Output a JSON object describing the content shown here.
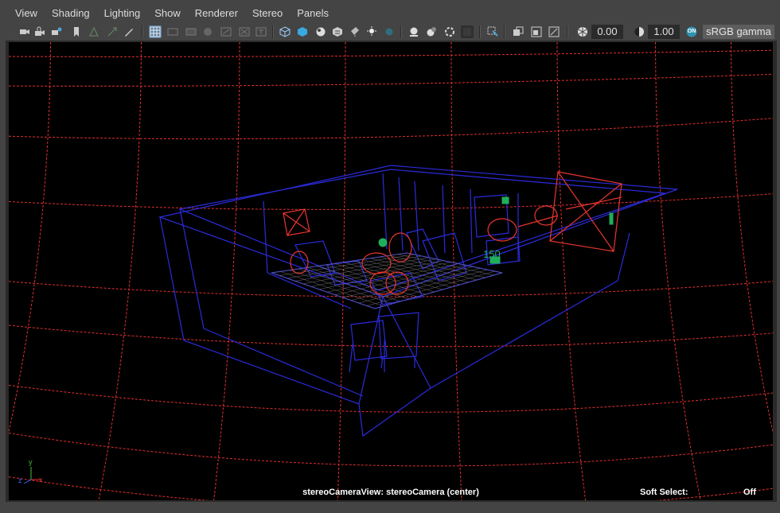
{
  "menu": [
    "View",
    "Shading",
    "Lighting",
    "Show",
    "Renderer",
    "Stereo",
    "Panels"
  ],
  "toolbar": {
    "exposure_value": "0.00",
    "gamma_value": "1.00",
    "color_management_badge": "ON",
    "color_space": "sRGB gamma",
    "icons": [
      "camera-select-icon",
      "camera-lock-icon",
      "camera-attributes-icon",
      "bookmark-icon",
      "image-plane-icon",
      "2d-pan-zoom-icon",
      "grease-pencil-icon",
      "grid-icon",
      "film-gate-icon",
      "resolution-gate-icon",
      "gate-mask-icon",
      "field-chart-icon",
      "safe-action-icon",
      "safe-title-icon",
      "wireframe-icon",
      "smooth-shade-icon",
      "default-material-icon",
      "textured-icon",
      "use-all-lights-icon",
      "shadows-icon",
      "screen-space-ao-icon",
      "motion-blur-icon",
      "anti-aliasing-icon",
      "depth-of-field-icon",
      "isolate-select-icon",
      "xray-icon",
      "xray-joints-icon",
      "xray-components-icon",
      "exposure-icon",
      "gamma-icon",
      "color-management-icon"
    ]
  },
  "viewport": {
    "camera_label": "stereoCameraView: stereoCamera (center)",
    "soft_select_label": "Soft Select:",
    "soft_select_value": "Off",
    "scene_label": "150",
    "axis": {
      "x": "x",
      "y": "y",
      "z": "z"
    },
    "colors": {
      "background": "#000000",
      "dome_grid": "#e0302e",
      "wireframe": "#2b2bdc",
      "selected": "#e8352e",
      "lights": "#1fae5a"
    }
  }
}
